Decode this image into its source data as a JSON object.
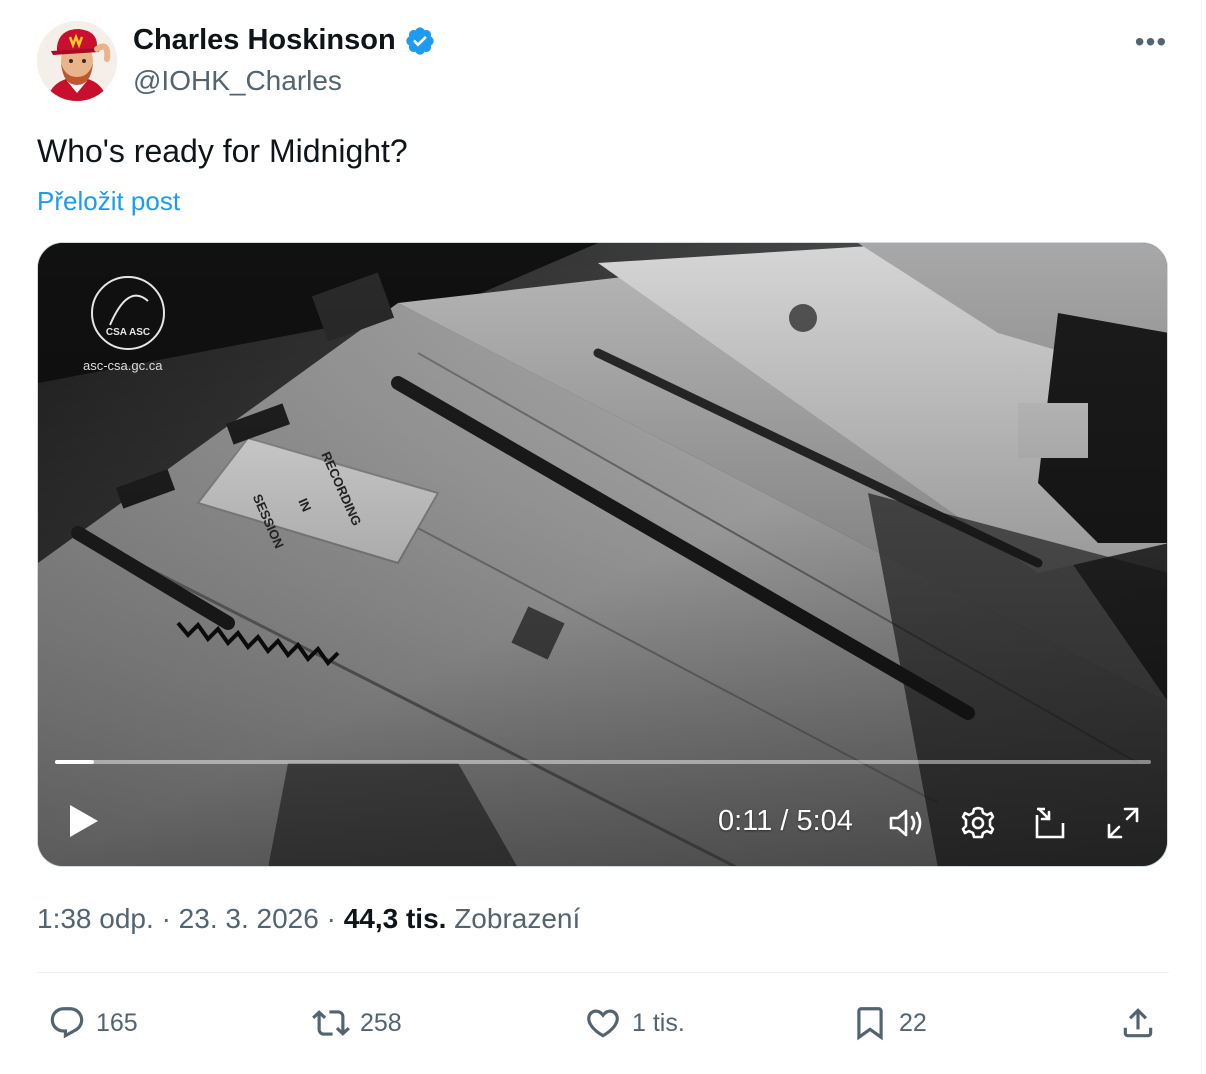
{
  "author": {
    "name": "Charles Hoskinson",
    "handle": "@IOHK_Charles",
    "avatar_icon": "avatar-image",
    "verified_color": "#1d9bf0"
  },
  "post": {
    "text": "Who's ready for Midnight?",
    "translate_label": "Přeložit post"
  },
  "video": {
    "watermark_logo_text": "CSA ASC",
    "watermark_url": "asc-csa.gc.ca",
    "sign_text": [
      "RECORDING",
      "IN",
      "SESSION"
    ],
    "current_time": "0:11",
    "duration": "5:04",
    "time_label": "0:11 / 5:04",
    "progress_fraction": 0.036,
    "controls": [
      "play-icon",
      "volume-icon",
      "settings-icon",
      "pip-icon",
      "fullscreen-icon"
    ]
  },
  "meta": {
    "time": "1:38 odp.",
    "date": "23. 3. 2026",
    "views_count": "44,3 tis.",
    "views_label": "Zobrazení"
  },
  "actions": {
    "replies": "165",
    "reposts": "258",
    "likes": "1 tis.",
    "bookmarks": "22"
  },
  "colors": {
    "accent": "#1d9bf0",
    "secondary_text": "#536471",
    "primary_text": "#0f1419"
  }
}
